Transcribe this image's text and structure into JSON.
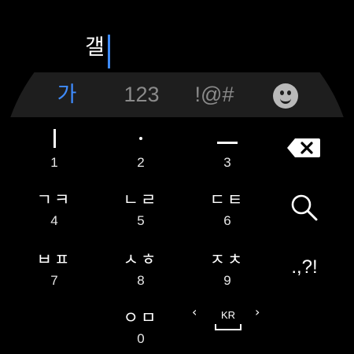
{
  "input": {
    "text": "갤"
  },
  "modes": [
    {
      "label": "가",
      "active": true
    },
    {
      "label": "123",
      "active": false
    },
    {
      "label": "!@#",
      "active": false
    }
  ],
  "emoji_icon": "smiley-face-icon",
  "keys": [
    {
      "glyph": "",
      "num": "1",
      "symbol": "vertical-stroke"
    },
    {
      "glyph": "",
      "num": "2",
      "symbol": "dot"
    },
    {
      "glyph": "",
      "num": "3",
      "symbol": "horizontal-stroke"
    },
    {
      "glyph": "ㄱㅋ",
      "num": "4"
    },
    {
      "glyph": "ㄴㄹ",
      "num": "5"
    },
    {
      "glyph": "ㄷㅌ",
      "num": "6"
    },
    {
      "glyph": "ㅂㅍ",
      "num": "7"
    },
    {
      "glyph": "ㅅㅎ",
      "num": "8"
    },
    {
      "glyph": "ㅈㅊ",
      "num": "9"
    },
    {
      "glyph": "ㅇㅁ",
      "num": "0"
    }
  ],
  "side": {
    "backspace_icon": "backspace-icon",
    "search_icon": "search-icon",
    "punctuation": ".,?!"
  },
  "language": {
    "code": "KR",
    "left": "‹",
    "right": "›"
  },
  "colors": {
    "accent": "#3f8cff",
    "mode_bar": "#1e1e1e",
    "inactive": "#8a8a8a"
  }
}
